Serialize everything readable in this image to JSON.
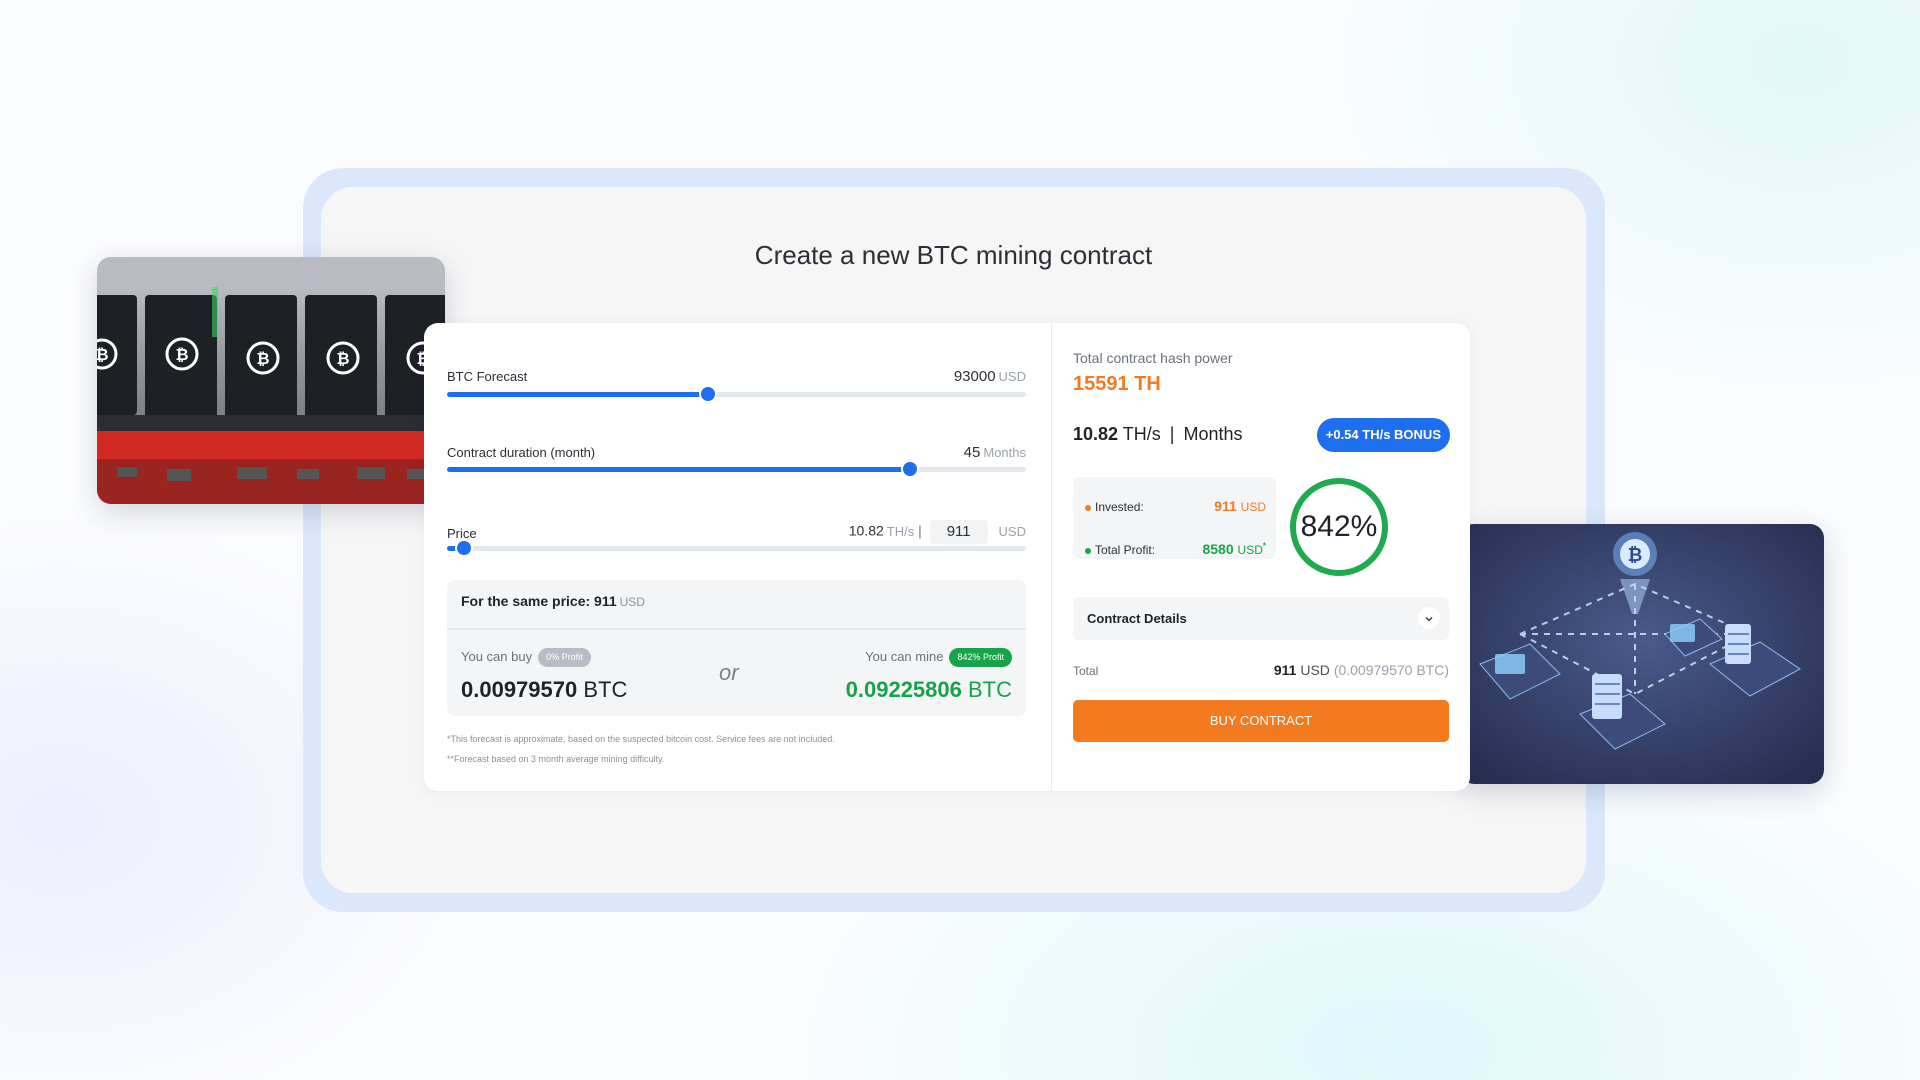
{
  "page": {
    "title": "Create a new BTC mining contract"
  },
  "sliders": {
    "forecast": {
      "label": "BTC Forecast",
      "value": "93000",
      "unit": "USD",
      "fraction": 0.45
    },
    "duration": {
      "label": "Contract duration (month)",
      "value": "45",
      "unit": "Months",
      "fraction": 0.8
    },
    "price": {
      "label": "Price",
      "speed": "10.82",
      "speed_unit": "TH/s",
      "separator": "|",
      "amount": "911",
      "unit": "USD",
      "fraction": 0.03
    }
  },
  "compare": {
    "heading": "For the same price:",
    "price": "911",
    "unit": "USD",
    "buy_label": "You can buy",
    "buy_badge": "0% Profit",
    "buy_amount": "0.00979570",
    "buy_currency": "BTC",
    "or": "or",
    "mine_label": "You can mine",
    "mine_badge": "842% Profit",
    "mine_amount": "0.09225806",
    "mine_currency": "BTC"
  },
  "footnotes": [
    "*This forecast is approximate, based on the suspected bitcoin cost. Service fees are not included.",
    "**Forecast based on 3 month average mining difficulty."
  ],
  "summary": {
    "hash_label": "Total contract hash power",
    "hash_value": "15591 TH",
    "speed": "10.82",
    "speed_unit": "TH/s",
    "separator": "|",
    "period": "Months",
    "bonus": "+0.54 TH/s BONUS",
    "invested_label": "Invested:",
    "invested_value": "911",
    "invested_unit": "USD",
    "profit_label": "Total Profit:",
    "profit_value": "8580",
    "profit_unit": "USD",
    "profit_mark": "*",
    "roi": "842%",
    "roi_fraction": 1.0,
    "details_label": "Contract Details",
    "total_label": "Total",
    "total_value": "911",
    "total_unit": "USD",
    "total_btc": "(0.00979570 BTC)",
    "buy_button": "BUY CONTRACT"
  },
  "colors": {
    "accent_blue": "#1e6ef0",
    "accent_orange": "#f47a20",
    "hash_orange": "#f27a22",
    "profit_green": "#18a34b",
    "ring_green": "#1faa4f"
  },
  "icons": {
    "chevron": "chevron-down-icon",
    "bitcoin": "bitcoin-icon"
  }
}
